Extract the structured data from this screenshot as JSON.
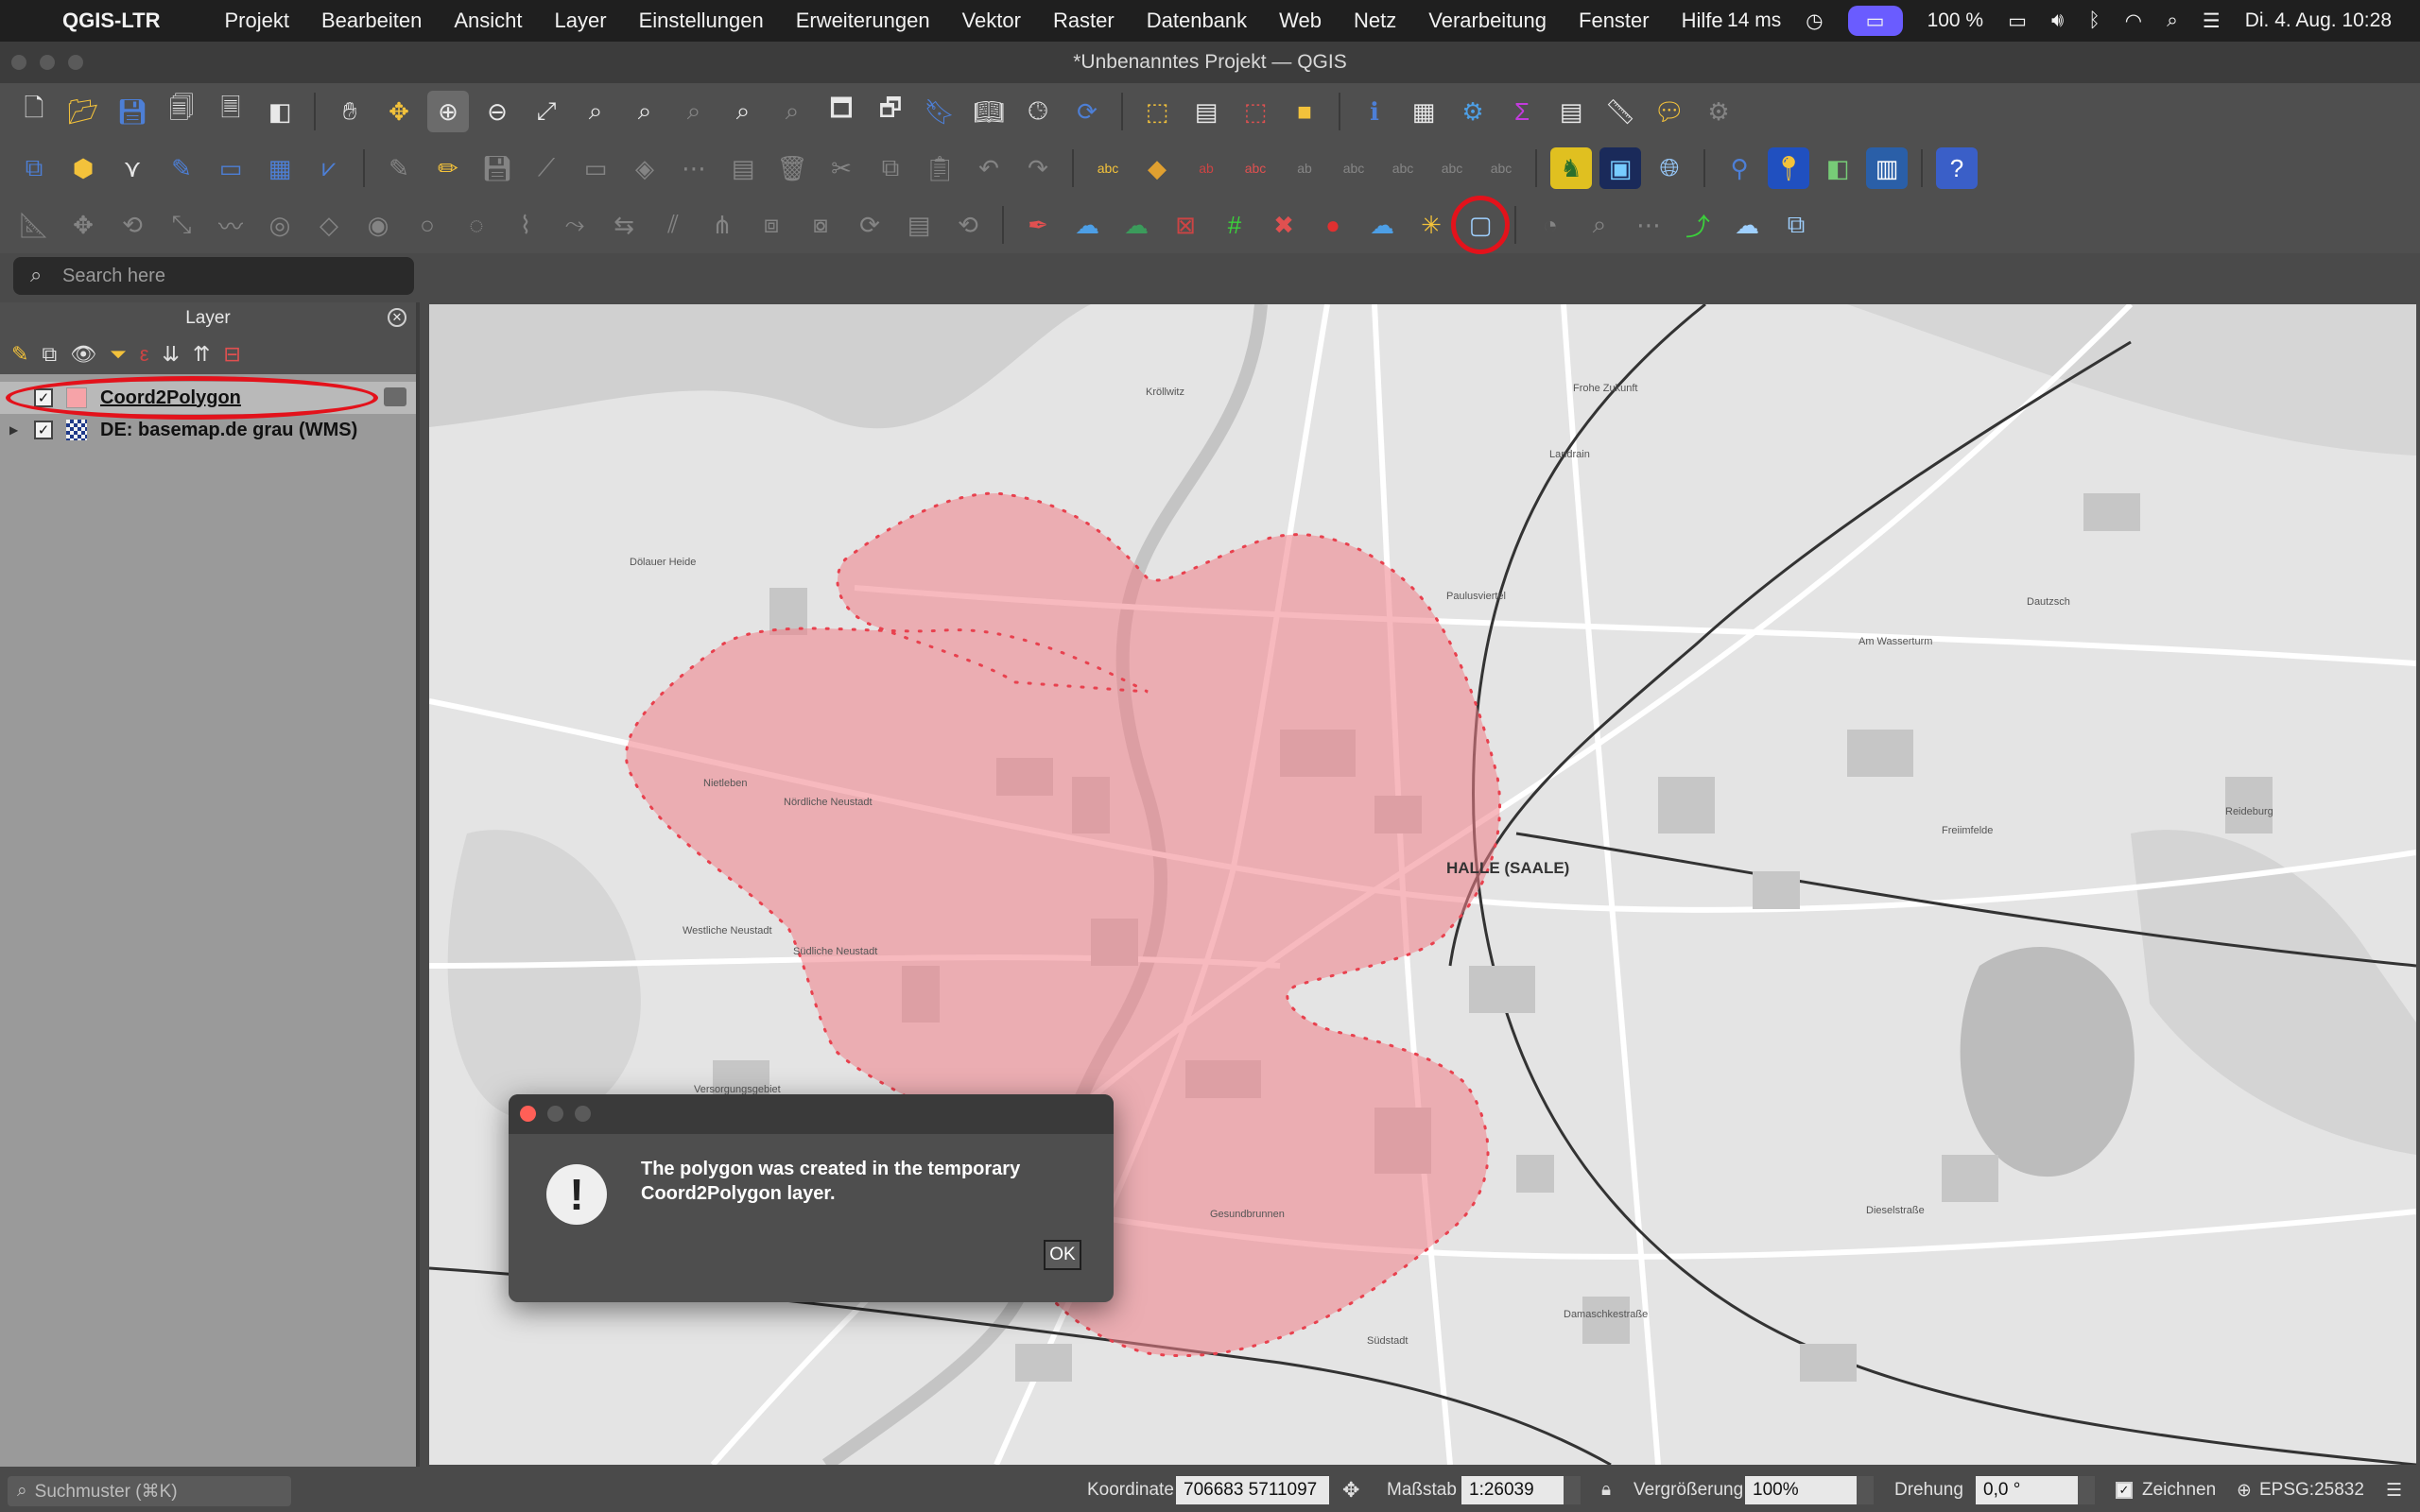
{
  "menubar": {
    "app": "QGIS-LTR",
    "items": [
      "Projekt",
      "Bearbeiten",
      "Ansicht",
      "Layer",
      "Einstellungen",
      "Erweiterungen",
      "Vektor",
      "Raster",
      "Datenbank",
      "Web",
      "Netz",
      "Verarbeitung",
      "Fenster",
      "Hilfe"
    ],
    "render_time": "14 ms",
    "battery": "100 %",
    "datetime": "Di. 4. Aug.  10:28"
  },
  "window": {
    "title": "*Unbenanntes Projekt — QGIS"
  },
  "search": {
    "placeholder": "Search here"
  },
  "layers_panel": {
    "title": "Layer",
    "layers": [
      {
        "name": "Coord2Polygon",
        "checked": true,
        "swatch": "#f6a3a8"
      },
      {
        "name": "DE: basemap.de grau (WMS)",
        "checked": true
      }
    ]
  },
  "map": {
    "labels": {
      "city": "HALLE (SAALE)",
      "nietleben": "Nietleben",
      "neustadt_n": "Nördliche Neustadt",
      "neustadt_s": "Südliche Neustadt",
      "westliche": "Westliche Neustadt",
      "doelauer": "Dölauer Heide",
      "kroellwitz": "Kröllwitz",
      "freiimfelde": "Freiimfelde",
      "gesundbrunnen": "Gesundbrunnen",
      "suedstadt": "Südstadt",
      "paulusviertel": "Paulusviertel",
      "frohe": "Frohe Zukunft",
      "landrain": "Landrain",
      "dieselstrasse": "Dieselstraße",
      "reideburg": "Reideburg",
      "damaschke": "Damaschkestraße",
      "dautzsch": "Dautzsch",
      "versorgung": "Versorgungsgebiet",
      "wasserturm": "Am Wasserturm"
    },
    "colors": {
      "polygon_fill": "#f07f88",
      "polygon_stroke": "#e8414e"
    }
  },
  "dialog": {
    "message": "The polygon was created in the temporary Coord2Polygon layer.",
    "ok_label": "OK"
  },
  "statusbar": {
    "search_placeholder": "Suchmuster (⌘K)",
    "coord_label": "Koordinate",
    "coord_value": "706683  5711097",
    "scale_label": "Maßstab",
    "scale_value": "1:26039",
    "magnifier_label": "Vergrößerung",
    "magnifier_value": "100%",
    "rotation_label": "Drehung",
    "rotation_value": "0,0 °",
    "render_label": "Zeichnen",
    "crs": "EPSG:25832"
  }
}
